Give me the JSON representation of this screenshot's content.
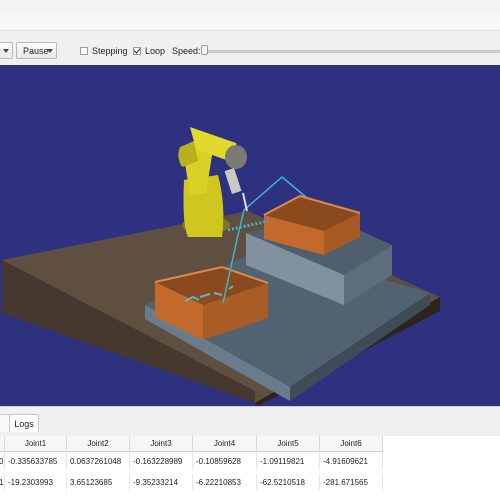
{
  "toolbar": {
    "play_label": "",
    "pause_label": "Pause",
    "stepping_label": "Stepping",
    "stepping_checked": false,
    "loop_label": "Loop",
    "loop_checked": true,
    "speed_label": "Speed:",
    "speed_value": 0
  },
  "tabs": [
    {
      "label": ""
    },
    {
      "label": "Logs"
    }
  ],
  "joint_table": {
    "headers": [
      "",
      "Joint1",
      "Joint2",
      "Joint3",
      "Joint4",
      "Joint5",
      "Joint6"
    ],
    "rows": [
      [
        "0",
        "-0.335633785",
        "0.0637261048",
        "-0.163228989",
        "-0.10859628",
        "-1.09119821",
        "-4.91609621"
      ],
      [
        "1",
        "-19.2303993",
        "3.65123685",
        "-9.35233214",
        "-6.22210853",
        "-62.5210518",
        "-281.671565"
      ]
    ]
  },
  "colors": {
    "viewport_background": "#2e3180",
    "robot": "#d6d023",
    "bins": "#c4692c",
    "platform": "#5c6e80"
  }
}
